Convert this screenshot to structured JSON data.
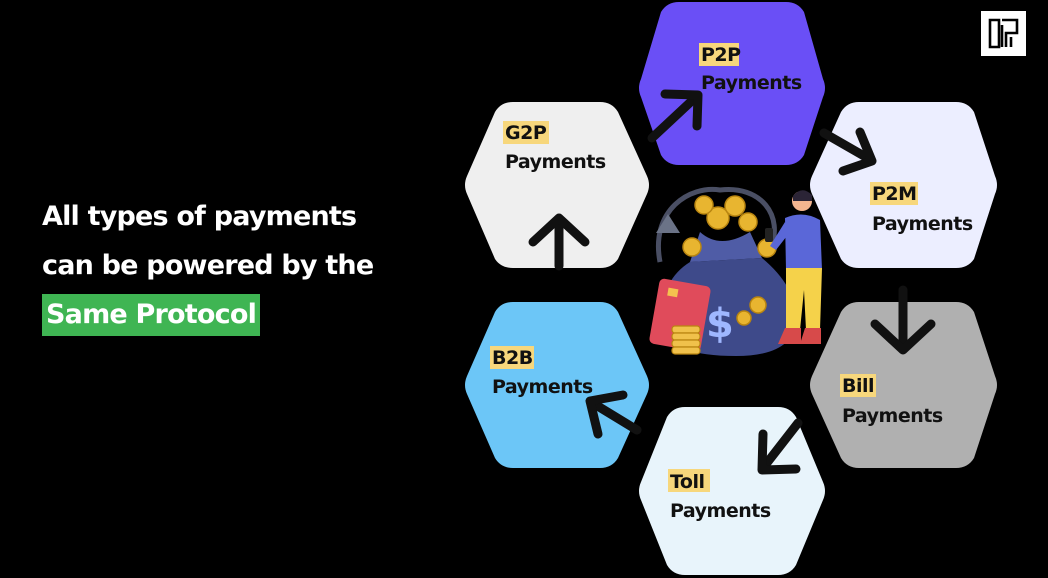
{
  "headline": {
    "line1": "All  types of payments",
    "line2": "can be powered by the",
    "highlight": "Same Protocol"
  },
  "colors": {
    "background": "#000000",
    "highlight": "#3fb553",
    "label_highlight": "#f7d77c",
    "p2p": "#6a4ff6",
    "p2m": "#eceeff",
    "bill": "#b0b0b0",
    "toll": "#e8f4fb",
    "b2b": "#6cc6f7",
    "g2p": "#efefef"
  },
  "hexagons": [
    {
      "id": "p2p",
      "title": "P2P",
      "subtitle": "Payments"
    },
    {
      "id": "p2m",
      "title": "P2M",
      "subtitle": "Payments"
    },
    {
      "id": "bill",
      "title": "Bill",
      "subtitle": "Payments"
    },
    {
      "id": "toll",
      "title": "Toll",
      "subtitle": "Payments"
    },
    {
      "id": "b2b",
      "title": "B2B",
      "subtitle": "Payments"
    },
    {
      "id": "g2p",
      "title": "G2P",
      "subtitle": "Payments"
    }
  ],
  "icons": {
    "logo": "brand-logo-icon",
    "center": "money-bag-person-illustration",
    "arrows": "flow-arrow-icon"
  }
}
